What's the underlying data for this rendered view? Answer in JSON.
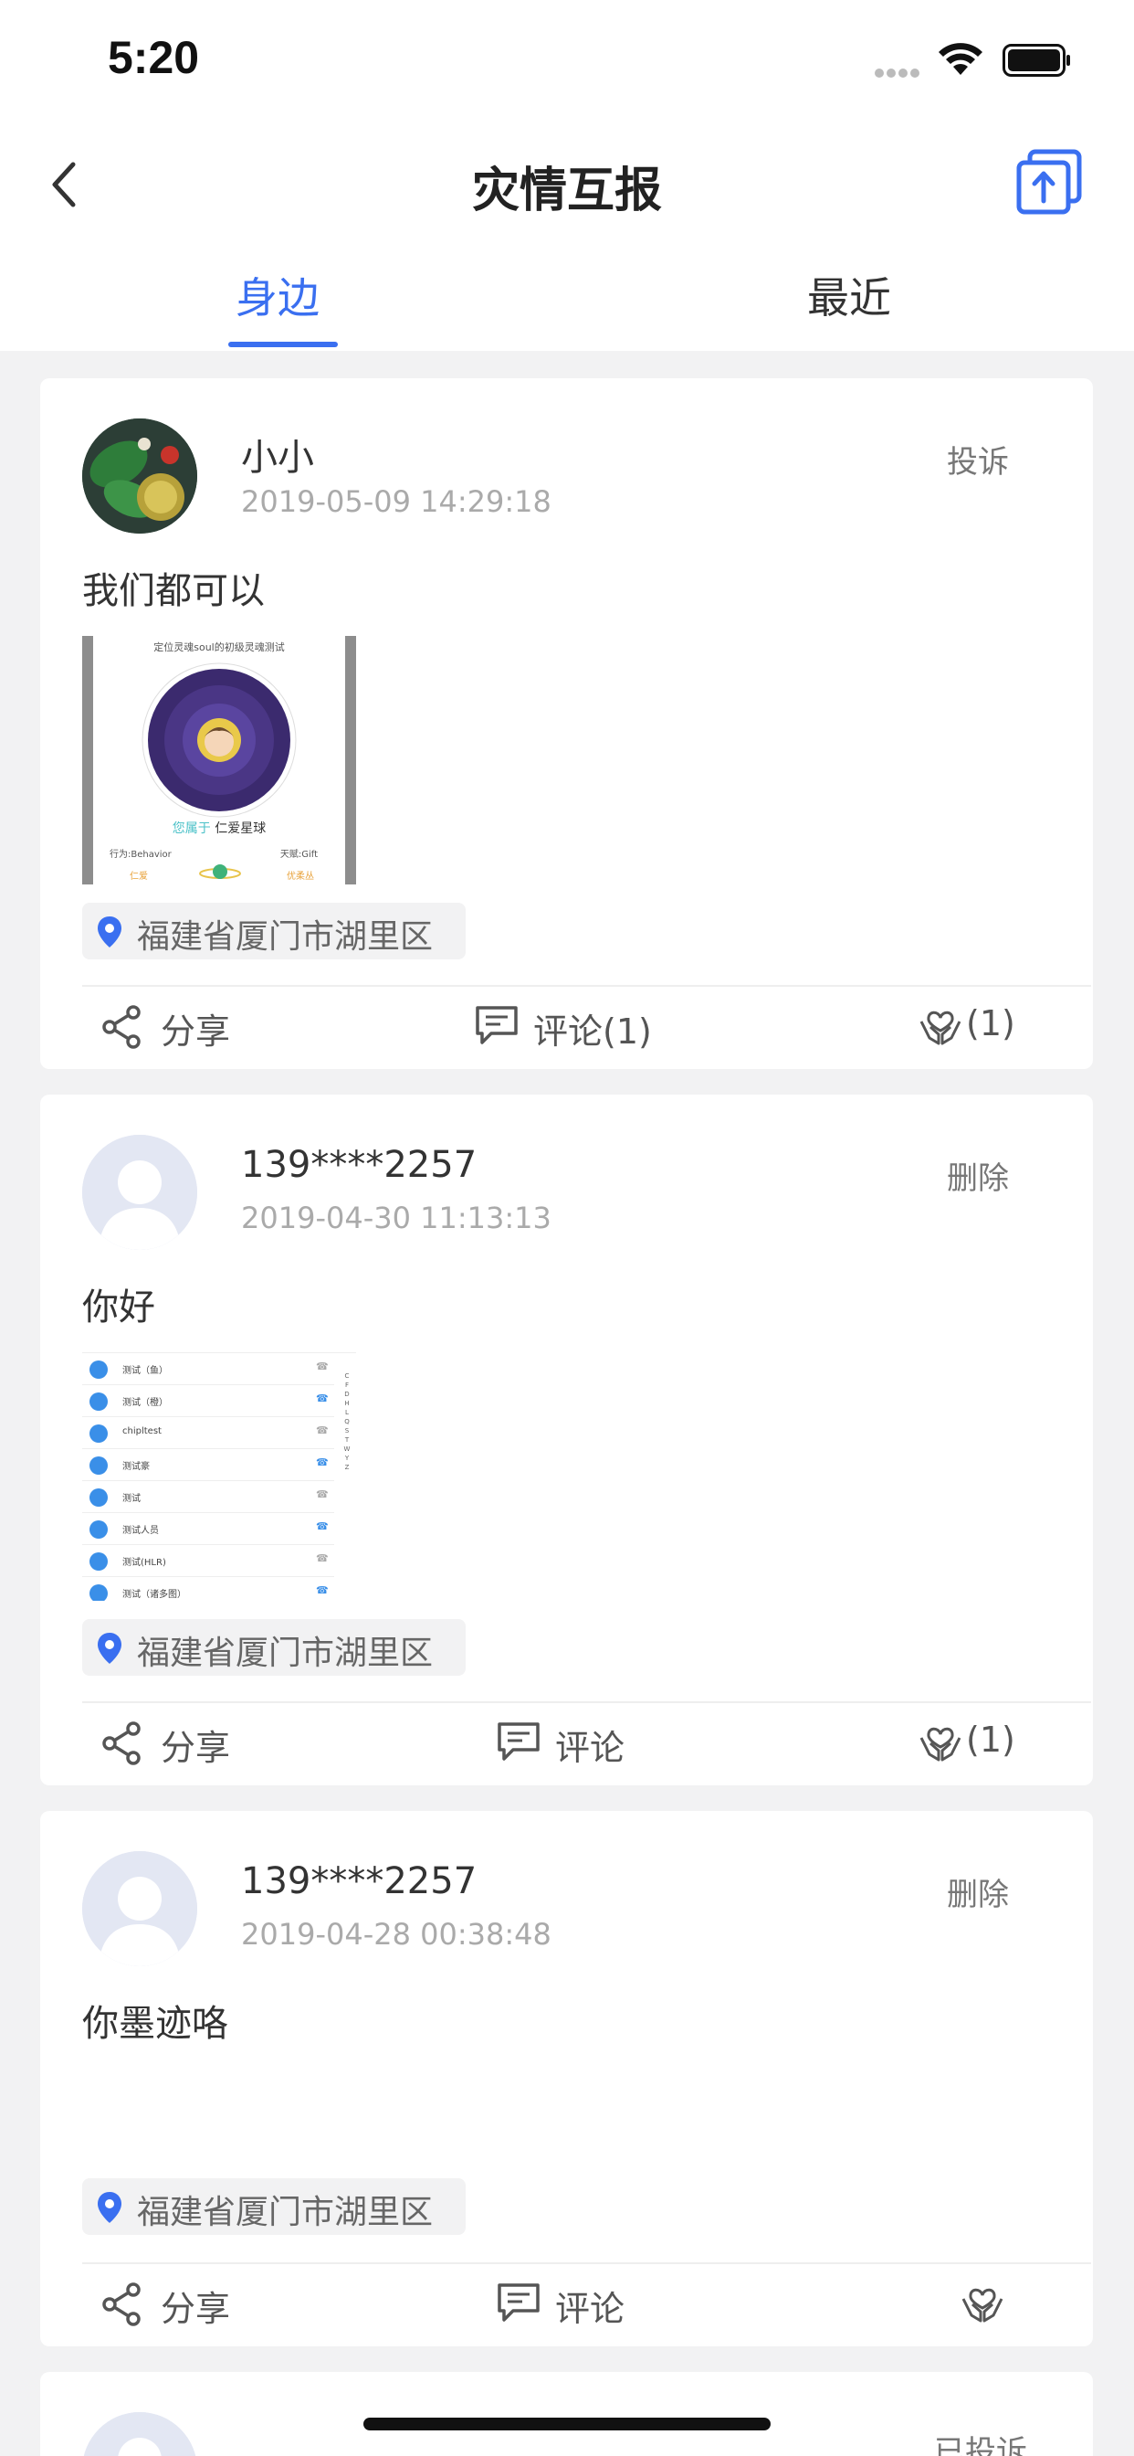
{
  "status": {
    "time": "5:20"
  },
  "nav": {
    "title": "灾情互报"
  },
  "tabs": [
    {
      "label": "身边"
    },
    {
      "label": "最近"
    }
  ],
  "posts": [
    {
      "user": "小小",
      "time": "2019-05-09 14:29:18",
      "action": "投诉",
      "text": "我们都可以",
      "location": "福建省厦门市湖里区",
      "share": "分享",
      "comment": "评论(1)",
      "like": "(1)",
      "image_texts": {
        "top": "定位灵魂soul的初级灵魂测试",
        "result_prefix": "您属于",
        "result": "仁爱星球",
        "left": "行为:Behavior",
        "right": "天赋:Gift",
        "left_val": "仁爱",
        "right_val": "优柔丛"
      }
    },
    {
      "user": "139****2257",
      "time": "2019-04-30 11:13:13",
      "action": "删除",
      "text": "你好",
      "location": "福建省厦门市湖里区",
      "share": "分享",
      "comment": "评论",
      "like": "(1)",
      "image_rows": [
        "测试（鱼）",
        "测试（橙）",
        "chipltest",
        "测试豪",
        "测试",
        "测试人员",
        "测试(HLR)",
        "测试（诸多图）"
      ]
    },
    {
      "user": "139****2257",
      "time": "2019-04-28 00:38:48",
      "action": "删除",
      "text": "你墨迹咯",
      "location": "福建省厦门市湖里区",
      "share": "分享",
      "comment": "评论",
      "like": ""
    },
    {
      "action": "已投诉"
    }
  ],
  "colors": {
    "accent": "#3a6ff0",
    "background": "#f2f2f3"
  }
}
